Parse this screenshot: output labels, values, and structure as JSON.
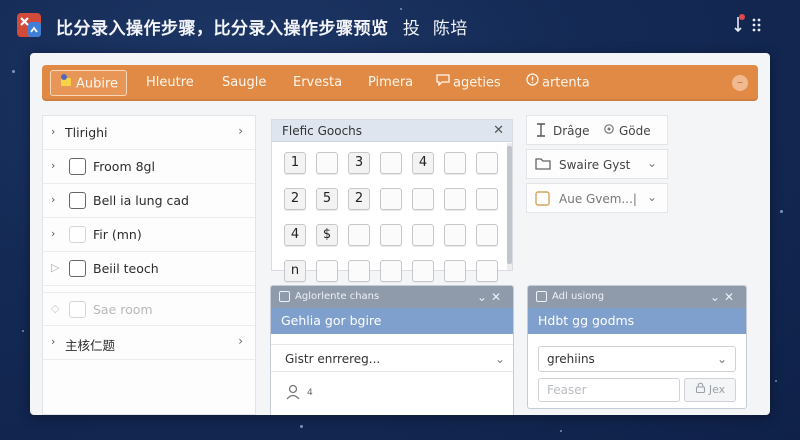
{
  "titlebar": {
    "title": "比分录入操作步骤，比分录入操作步骤预览",
    "extra1": "投",
    "extra2": "陈培"
  },
  "menubar": {
    "items": [
      "Aubire",
      "Hleutre",
      "Saugle",
      "Ervesta",
      "Pimera",
      "ageties",
      "artenta"
    ]
  },
  "tree": {
    "items": [
      {
        "label": "Tlirighi"
      },
      {
        "label": "Froom 8gl"
      },
      {
        "label": "Bell ia lung cad"
      },
      {
        "label": "Fir (mn)"
      },
      {
        "label": "Beiil teoch"
      },
      {
        "label": "Sae room"
      },
      {
        "label": "主核仁题"
      }
    ]
  },
  "keypad": {
    "title": "Flefic Goochs",
    "rows": [
      [
        "1",
        "",
        "3",
        "",
        "4",
        "",
        ""
      ],
      [
        "2",
        "5",
        "2",
        "",
        "",
        "",
        ""
      ],
      [
        "4",
        "$",
        "",
        "",
        "",
        "",
        ""
      ],
      [
        "n",
        "",
        "",
        "",
        "",
        "",
        ""
      ]
    ]
  },
  "options": {
    "top_left": "Drâge",
    "top_right": "Göde",
    "row2": "Swaire Gyst",
    "row3": "Aue Gvem...|"
  },
  "dialog_left": {
    "bar_title": "Aglorlente chans",
    "subtitle": "Gehlia gor bgire",
    "select_value": "Gistr enrrereg...",
    "footer_text": "4"
  },
  "dialog_right": {
    "bar_title": "Adl usiong",
    "subtitle": "Hdbt gg godms",
    "select_value": "grehiins",
    "input_placeholder": "Feaser",
    "button_label": "Jex"
  },
  "colors": {
    "menubar": "#e08a45",
    "dialog_bar": "#8f9aaa",
    "dialog_sub": "#7f9fcd",
    "background": "#142a55"
  }
}
